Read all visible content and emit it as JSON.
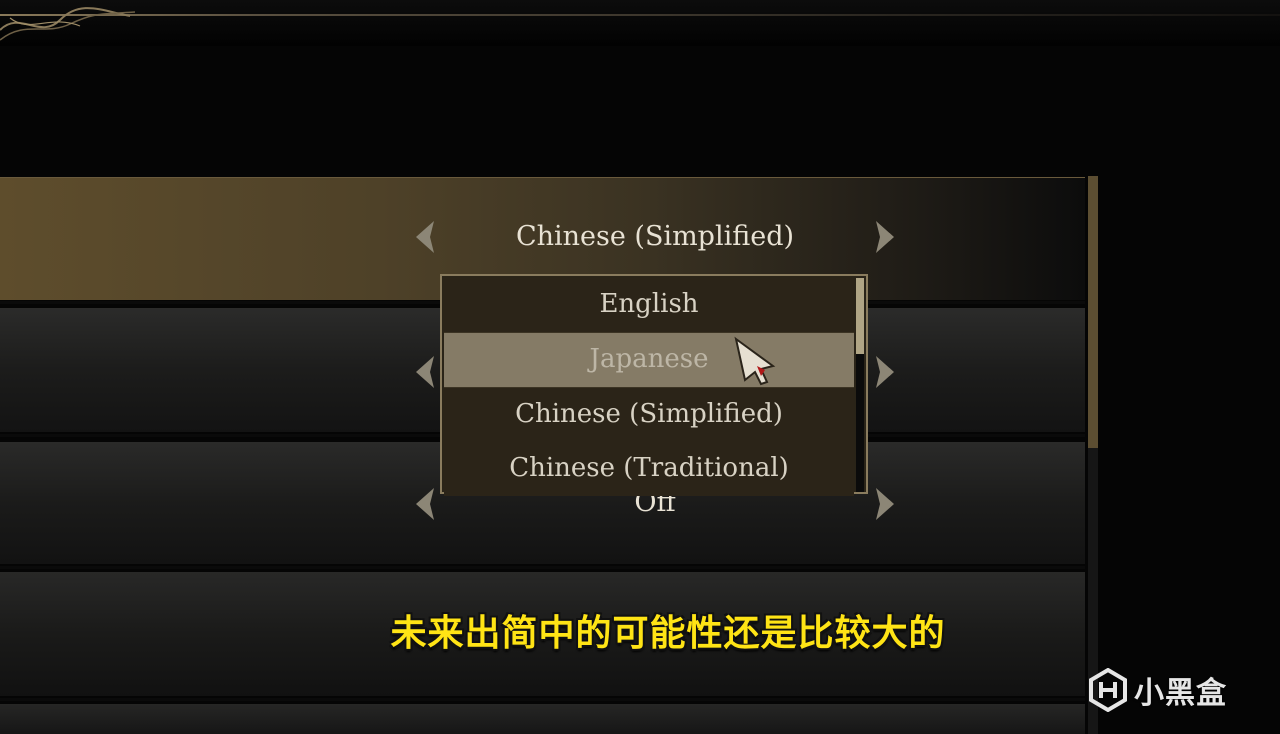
{
  "settings": {
    "language": {
      "value": "Chinese (Simplified)"
    },
    "row3": {
      "value": "Off"
    }
  },
  "dropdown": {
    "options": [
      {
        "label": "English",
        "state": "normal"
      },
      {
        "label": "Japanese",
        "state": "hover"
      },
      {
        "label": "Chinese (Simplified)",
        "state": "normal"
      },
      {
        "label": "Chinese (Traditional)",
        "state": "normal"
      }
    ]
  },
  "subtitle": {
    "text": "未来出简中的可能性还是比较大的"
  },
  "watermark": {
    "text": "小黑盒",
    "icon": "heybox-logo-icon"
  },
  "icons": {
    "prev": "chevron-left-icon",
    "next": "chevron-right-icon",
    "cursor": "pointer-cursor-icon"
  },
  "colors": {
    "accent_gold": "#8a7c5e",
    "hover_row": "#857b66",
    "subtitle_yellow": "#ffe415",
    "text": "#e8e2d4"
  }
}
